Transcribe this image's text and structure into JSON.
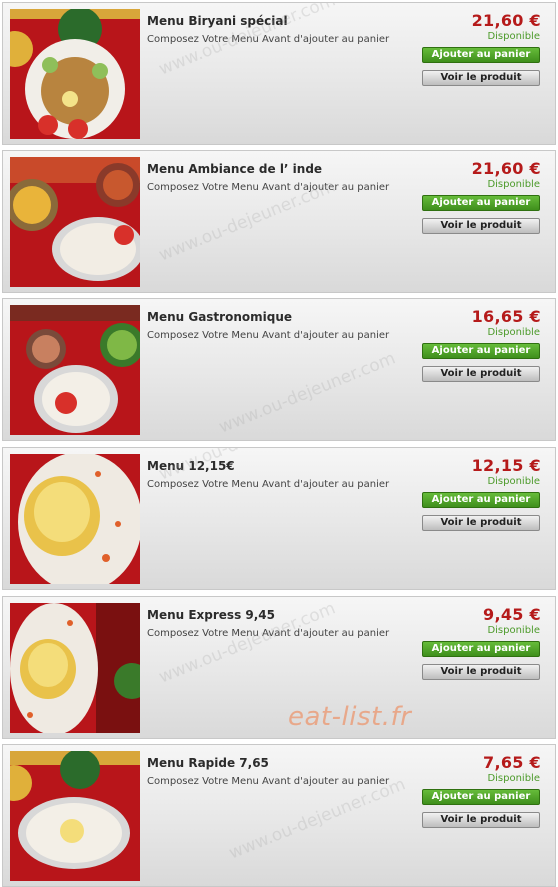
{
  "watermark": "www.ou-dejeuner.com",
  "brand": "eat-list.fr",
  "items": [
    {
      "title": "Menu Biryani spécial",
      "description": "Composez Votre Menu Avant d'ajouter au panier",
      "price": "21,60 €",
      "availability": "Disponible",
      "add_label": "Ajouter au panier",
      "view_label": "Voir le produit"
    },
    {
      "title": "Menu Ambiance de l’ inde",
      "description": "Composez Votre Menu Avant d'ajouter au panier",
      "price": "21,60 €",
      "availability": "Disponible",
      "add_label": "Ajouter au panier",
      "view_label": "Voir le produit"
    },
    {
      "title": "Menu Gastronomique",
      "description": "Composez Votre Menu Avant d'ajouter au panier",
      "price": "16,65 €",
      "availability": "Disponible",
      "add_label": "Ajouter au panier",
      "view_label": "Voir le produit"
    },
    {
      "title": "Menu 12,15€",
      "description": "Composez Votre Menu Avant d'ajouter au panier",
      "price": "12,15 €",
      "availability": "Disponible",
      "add_label": "Ajouter au panier",
      "view_label": "Voir le produit"
    },
    {
      "title": "Menu Express 9,45",
      "description": "Composez Votre Menu Avant d'ajouter au panier",
      "price": "9,45 €",
      "availability": "Disponible",
      "add_label": "Ajouter au panier",
      "view_label": "Voir le produit"
    },
    {
      "title": "Menu Rapide 7,65",
      "description": "Composez Votre Menu Avant d'ajouter au panier",
      "price": "7,65 €",
      "availability": "Disponible",
      "add_label": "Ajouter au panier",
      "view_label": "Voir le produit"
    }
  ],
  "colors": {
    "price": "#b51a1a",
    "available": "#4c9a2a",
    "add_button": "#4a9c24"
  }
}
